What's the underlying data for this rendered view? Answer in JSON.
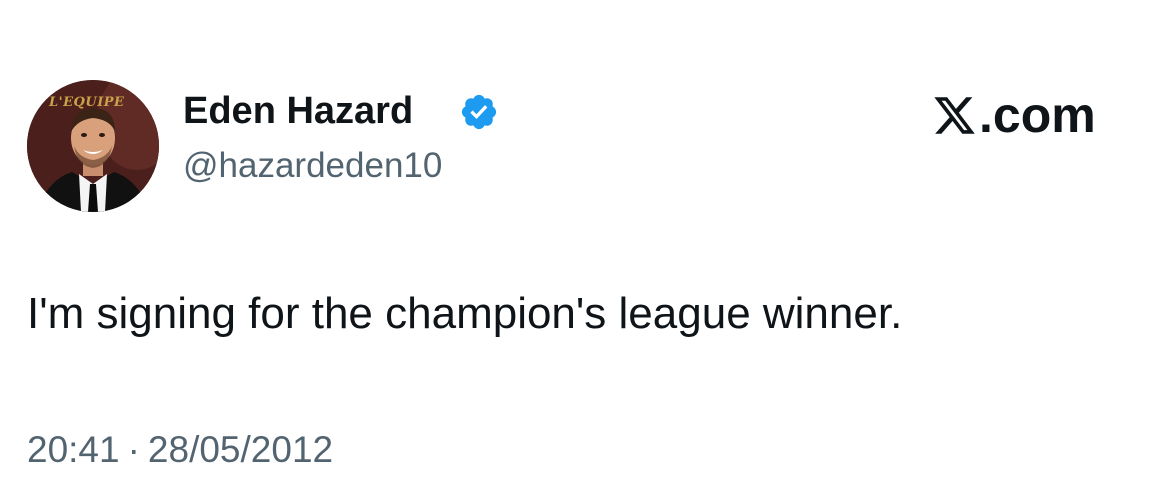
{
  "tweet": {
    "author": {
      "display_name": "Eden Hazard",
      "handle": "@hazardeden10",
      "verified": true,
      "avatar_logo_text": "L'EQUIPE"
    },
    "site_mark": {
      "label": ".com",
      "icon": "x-logo-icon"
    },
    "text": "I'm signing for the champion's league winner.",
    "time": "20:41",
    "separator": "·",
    "date": "28/05/2012"
  },
  "colors": {
    "text_primary": "#0f1419",
    "text_secondary": "#536471",
    "verified_blue": "#1d9bf0",
    "background": "#ffffff"
  }
}
